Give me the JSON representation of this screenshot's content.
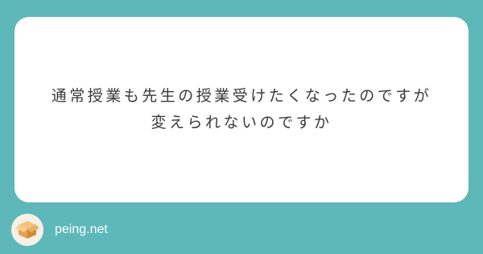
{
  "question": {
    "line1": "通常授業も先生の授業受けたくなったのですが",
    "line2": "変えられないのですか"
  },
  "footer": {
    "brand": "peing.net",
    "logo_icon": "cardboard-box-icon"
  },
  "colors": {
    "background": "#5eb8b9",
    "card": "#ffffff",
    "text": "#3a3a3a",
    "brand_text": "#ffffff",
    "box_main": "#e4a24f"
  }
}
